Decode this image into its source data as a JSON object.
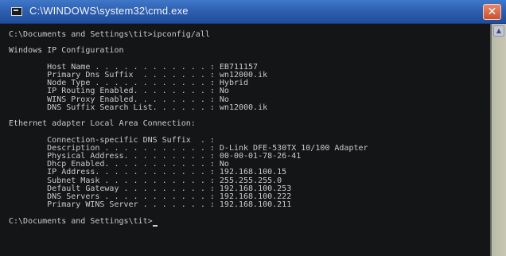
{
  "window": {
    "title": "C:\\WINDOWS\\system32\\cmd.exe",
    "close_glyph": "✕"
  },
  "icons": {
    "title_icon": "cmd-window-icon",
    "close_icon": "close-icon",
    "scroll_up_icon": "scroll-up-arrow-icon"
  },
  "console": {
    "lines": [
      "C:\\Documents and Settings\\tit>ipconfig/all",
      "",
      "Windows IP Configuration",
      "",
      "        Host Name . . . . . . . . . . . . : EB711157",
      "        Primary Dns Suffix  . . . . . . . : wn12000.ik",
      "        Node Type . . . . . . . . . . . . : Hybrid",
      "        IP Routing Enabled. . . . . . . . : No",
      "        WINS Proxy Enabled. . . . . . . . : No",
      "        DNS Suffix Search List. . . . . . : wn12000.ik",
      "",
      "Ethernet adapter Local Area Connection:",
      "",
      "        Connection-specific DNS Suffix  . :",
      "        Description . . . . . . . . . . . : D-Link DFE-530TX 10/100 Adapter",
      "        Physical Address. . . . . . . . . : 00-00-01-78-26-41",
      "        Dhcp Enabled. . . . . . . . . . . : No",
      "        IP Address. . . . . . . . . . . . : 192.168.100.15",
      "        Subnet Mask . . . . . . . . . . . : 255.255.255.0",
      "        Default Gateway . . . . . . . . . : 192.168.100.253",
      "        DNS Servers . . . . . . . . . . . : 192.168.100.222",
      "        Primary WINS Server . . . . . . . : 192.168.100.211",
      "",
      "C:\\Documents and Settings\\tit>"
    ]
  }
}
